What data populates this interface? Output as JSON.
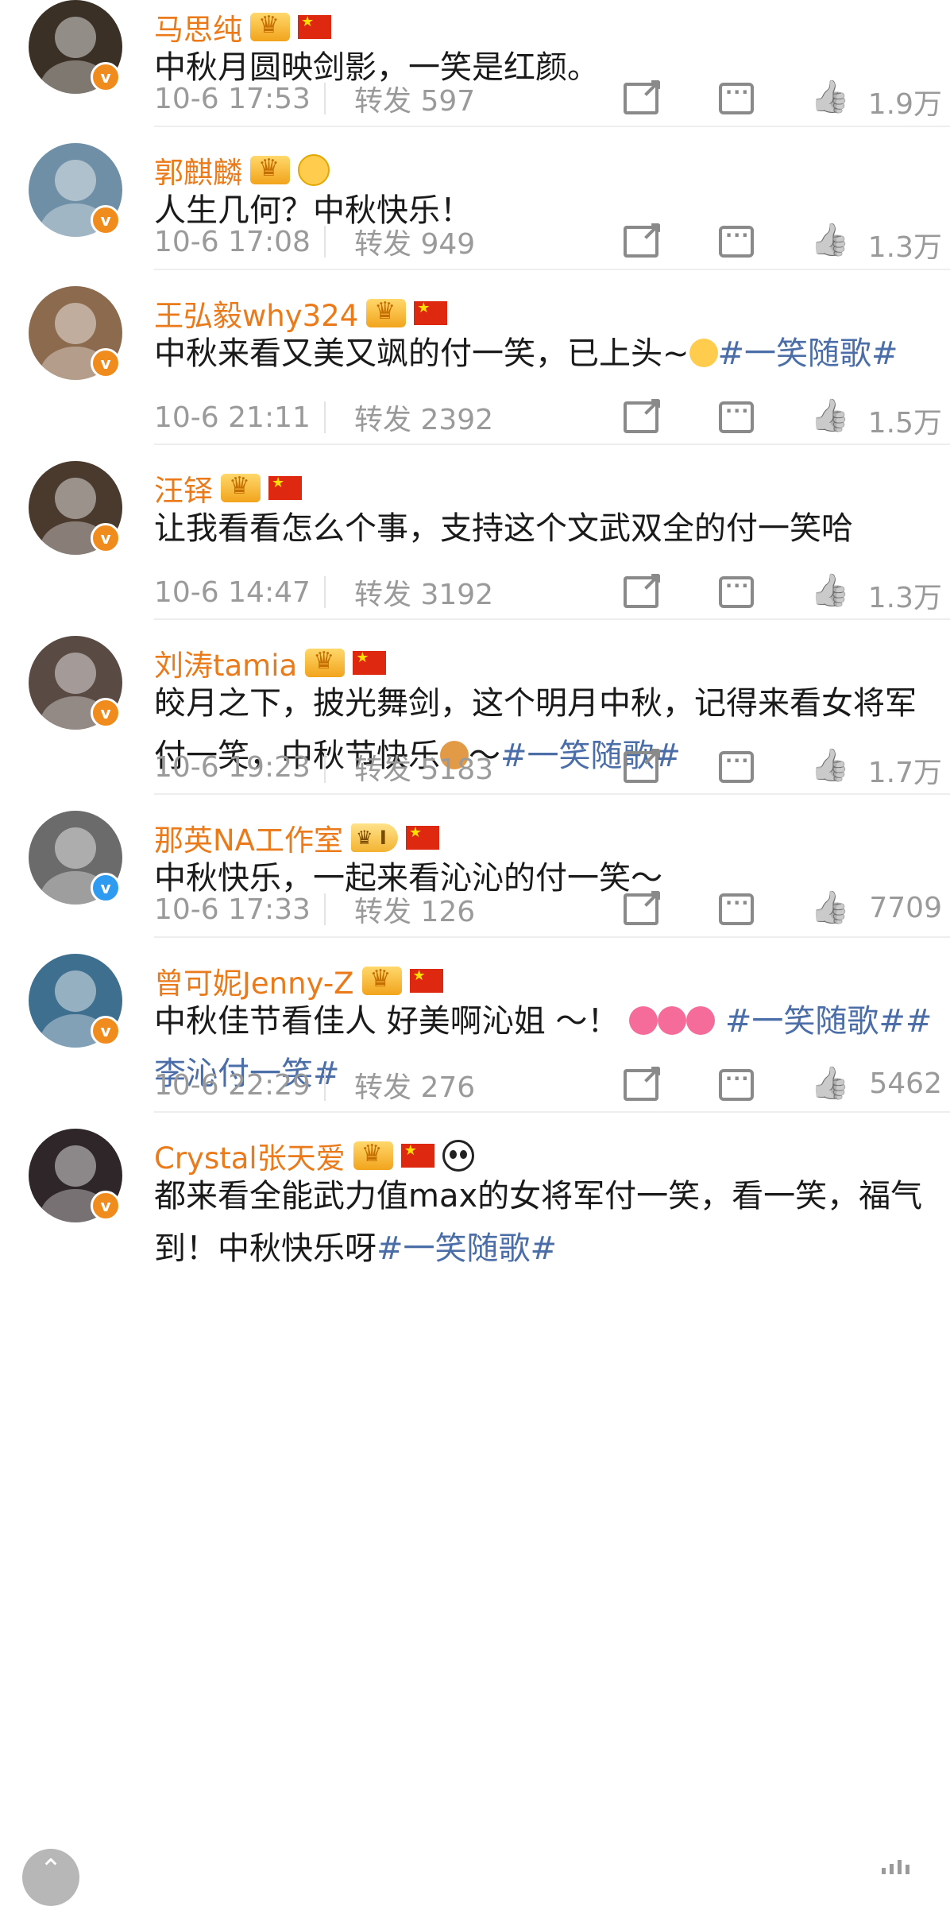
{
  "comments": [
    {
      "name": "马思纯",
      "text": [
        {
          "t": "中秋月圆映剑影，一笑是红颜。"
        }
      ],
      "time": "10-6 17:53",
      "repost": "转发 597",
      "likes": "1.9万",
      "badges": [
        "crown-icon",
        "china-flag-icon"
      ],
      "verified": "orange",
      "avatar_color": "#3a3026"
    },
    {
      "name": "郭麒麟",
      "text": [
        {
          "t": "人生几何？中秋快乐！"
        }
      ],
      "time": "10-6 17:08",
      "repost": "转发 949",
      "likes": "1.3万",
      "badges": [
        "crown-icon",
        "pufferfish-emoji-icon"
      ],
      "verified": "orange",
      "avatar_color": "#6f8fa6"
    },
    {
      "name": "王弘毅why324",
      "text": [
        {
          "t": "中秋来看又美又飒的付一笑，已上头~"
        },
        {
          "emoji": "#ffcc4d"
        },
        {
          "t": "#一笑随歌#",
          "tag": true
        }
      ],
      "time": "10-6 21:11",
      "repost": "转发 2392",
      "likes": "1.5万",
      "badges": [
        "crown-icon",
        "china-flag-icon"
      ],
      "verified": "orange",
      "avatar_color": "#8c6a4e"
    },
    {
      "name": "汪铎",
      "text": [
        {
          "t": "让我看看怎么个事，支持这个文武双全的付一笑哈"
        }
      ],
      "time": "10-6 14:47",
      "repost": "转发 3192",
      "likes": "1.3万",
      "badges": [
        "crown-icon",
        "china-flag-icon"
      ],
      "verified": "orange",
      "avatar_color": "#4a3a2e"
    },
    {
      "name": "刘涛tamia",
      "text": [
        {
          "t": "皎月之下，披光舞剑，这个明月中秋，记得来看女将军付一笑，中秋节快乐"
        },
        {
          "emoji": "#e39a47"
        },
        {
          "t": "～"
        },
        {
          "t": "#一笑随歌#",
          "tag": true
        }
      ],
      "time": "10-6 19:23",
      "repost": "转发 5183",
      "likes": "1.7万",
      "badges": [
        "crown-icon",
        "china-flag-icon"
      ],
      "verified": "orange",
      "avatar_color": "#5a4a44"
    },
    {
      "name": "那英NA工作室",
      "text": [
        {
          "t": "中秋快乐，一起来看沁沁的付一笑～"
        }
      ],
      "time": "10-6 17:33",
      "repost": "转发 126",
      "likes": "7709",
      "badges": [
        "level-badge",
        "china-flag-icon"
      ],
      "level": "I",
      "verified": "blue",
      "avatar_color": "#6b6b6b"
    },
    {
      "name": "曾可妮Jenny-Z",
      "text": [
        {
          "t": "中秋佳节看佳人 好美啊沁姐 ～！ "
        },
        {
          "emoji": "#f56c9a"
        },
        {
          "emoji": "#f56c9a"
        },
        {
          "emoji": "#f56c9a"
        },
        {
          "t": " "
        },
        {
          "t": "#一笑随歌#",
          "tag": true
        },
        {
          "t": "#李沁付一笑#",
          "tag": true
        }
      ],
      "time": "10-6 22:29",
      "repost": "转发 276",
      "likes": "5462",
      "badges": [
        "crown-icon",
        "china-flag-icon"
      ],
      "verified": "orange",
      "avatar_color": "#3f6f8f"
    },
    {
      "name": "Crystal张天爱",
      "text": [
        {
          "t": "都来看全能武力值max的女将军付一笑，看一笑，福气到！中秋快乐呀"
        },
        {
          "t": "#一笑随歌#",
          "tag": true
        }
      ],
      "time": "",
      "repost": "",
      "likes": "",
      "badges": [
        "crown-icon",
        "china-flag-icon",
        "panda-emoji-icon"
      ],
      "verified": "orange",
      "avatar_color": "#2e2628"
    }
  ],
  "scroll_top": {
    "icon": "chevron-up-icon",
    "glyph": "⌃"
  }
}
